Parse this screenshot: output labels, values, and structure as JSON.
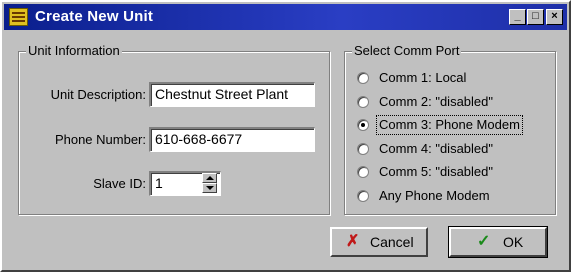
{
  "window": {
    "title": "Create New Unit",
    "buttons": {
      "minimize": "_",
      "maximize": "□",
      "close": "×"
    }
  },
  "unit_info": {
    "legend": "Unit Information",
    "description_label": "Unit Description:",
    "description_value": "Chestnut Street Plant",
    "phone_label": "Phone Number:",
    "phone_value": "610-668-6677",
    "slave_label": "Slave ID:",
    "slave_value": "1"
  },
  "comm_port": {
    "legend": "Select Comm Port",
    "selected_index": 2,
    "options": [
      {
        "label": "Comm 1: Local"
      },
      {
        "label": "Comm 2: \"disabled\""
      },
      {
        "label": "Comm 3: Phone Modem"
      },
      {
        "label": "Comm 4: \"disabled\""
      },
      {
        "label": "Comm 5: \"disabled\""
      },
      {
        "label": "Any Phone Modem"
      }
    ]
  },
  "actions": {
    "cancel_label": "Cancel",
    "cancel_icon": "✗",
    "cancel_color": "#c01818",
    "ok_label": "OK",
    "ok_icon": "✓",
    "ok_color": "#1a8a1a"
  }
}
